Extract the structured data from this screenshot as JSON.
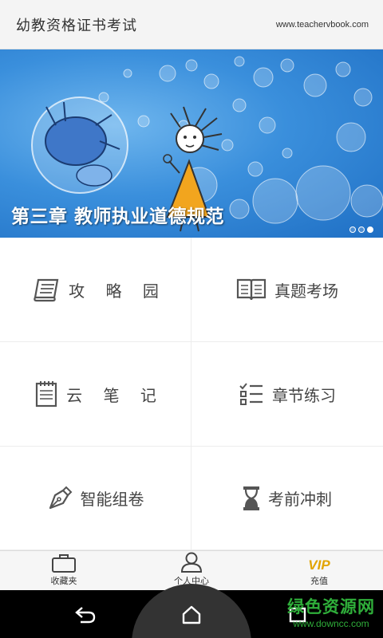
{
  "header": {
    "title": "幼教资格证书考试",
    "site": "www.teachervbook.com"
  },
  "banner": {
    "caption": "第三章 教师执业道德规范",
    "page_count": 3,
    "active_index": 2
  },
  "menu": [
    {
      "label": "攻 略 园",
      "icon": "scroll-icon"
    },
    {
      "label": "真题考场",
      "icon": "open-book-icon"
    },
    {
      "label": "云 笔 记",
      "icon": "notepad-icon"
    },
    {
      "label": "章节练习",
      "icon": "checklist-icon"
    },
    {
      "label": "智能组卷",
      "icon": "pen-nib-icon"
    },
    {
      "label": "考前冲刺",
      "icon": "hourglass-icon"
    }
  ],
  "tabbar": {
    "items": [
      {
        "label": "收藏夹",
        "icon": "briefcase-icon"
      },
      {
        "label": "个人中心",
        "icon": "person-icon"
      },
      {
        "label": "充值",
        "icon": "vip-icon",
        "icon_text": "VIP"
      }
    ]
  },
  "navbar": {
    "buttons": [
      "back-icon",
      "home-icon",
      "recent-apps-icon"
    ]
  },
  "watermark": {
    "title": "绿色资源网",
    "url": "www.downcc.com"
  },
  "colors": {
    "banner_blue": "#3a8fdc",
    "vip_gold": "#e2a400",
    "watermark_green": "#2fae3a"
  }
}
